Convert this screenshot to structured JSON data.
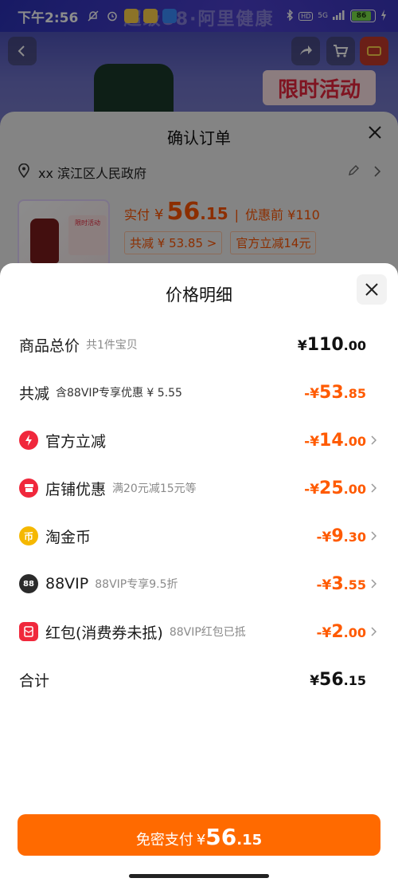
{
  "status_bar": {
    "time": "下午2:56",
    "network": "5G",
    "battery": "86"
  },
  "background": {
    "banner_text": "超级88·阿里健康",
    "promo_text": "限时活动"
  },
  "order_sheet": {
    "title": "确认订单",
    "address": "xx 滨江区人民政府",
    "pay_label": "实付",
    "pay_currency": "¥",
    "pay_int": "56",
    "pay_dec": ".15",
    "before_discount": "优惠前 ¥110",
    "chip_saved": "共减 ¥ 53.85 >",
    "chip_official": "官方立减14元",
    "thumb_promo": "限时活动"
  },
  "detail_sheet": {
    "title": "价格明细",
    "rows": [
      {
        "label": "商品总价",
        "sub": "共1件宝贝",
        "sign": "¥",
        "int": "110",
        "dec": ".00"
      },
      {
        "label": "共减",
        "sub": "含88VIP专享优惠 ¥ 5.55",
        "sign": "-¥",
        "int": "53",
        "dec": ".85"
      },
      {
        "label": "官方立减",
        "sub": "",
        "sign": "-¥",
        "int": "14",
        "dec": ".00"
      },
      {
        "label": "店铺优惠",
        "sub": "满20元减15元等",
        "sign": "-¥",
        "int": "25",
        "dec": ".00"
      },
      {
        "label": "淘金币",
        "sub": "",
        "sign": "-¥",
        "int": "9",
        "dec": ".30"
      },
      {
        "label": "88VIP",
        "sub": "88VIP专享9.5折",
        "sign": "-¥",
        "int": "3",
        "dec": ".55"
      },
      {
        "label": "红包(消费券未抵)",
        "sub": "88VIP红包已抵",
        "sign": "-¥",
        "int": "2",
        "dec": ".00"
      },
      {
        "label": "合计",
        "sub": "",
        "sign": "¥",
        "int": "56",
        "dec": ".15"
      }
    ],
    "icons": {
      "official": "lightning-icon",
      "shop": "shop-icon",
      "coin": "coin-icon",
      "vip_badge_text": "88",
      "coin_text": "币"
    }
  },
  "pay_button": {
    "label": "免密支付",
    "currency": "¥",
    "int": "56",
    "dec": ".15"
  },
  "colors": {
    "accent": "#ff6a00",
    "discount": "#ff5a00",
    "red_icon": "#f0283c",
    "coin_icon": "#f5b800"
  }
}
